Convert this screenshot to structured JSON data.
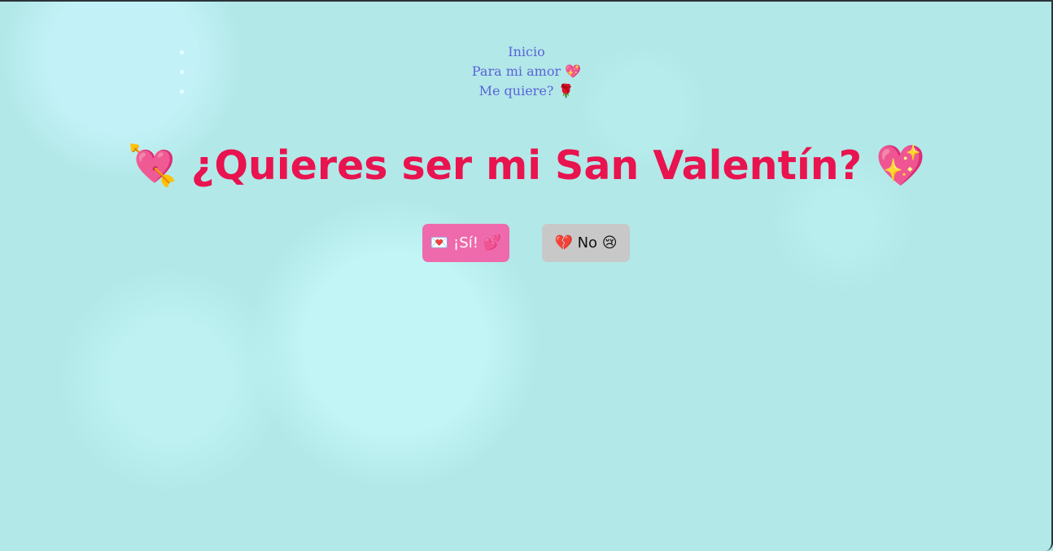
{
  "nav": {
    "items": [
      {
        "label": "Inicio"
      },
      {
        "label": "Para mi amor 💖"
      },
      {
        "label": "Me quiere? 🌹"
      }
    ]
  },
  "hero": {
    "title": "💘 ¿Quieres ser mi San Valentín? 💖"
  },
  "buttons": {
    "yes_label": "💌 ¡Sí! 💕",
    "no_label": "💔 No 😢"
  },
  "colors": {
    "background": "#b2e8e8",
    "title": "#e8134f",
    "nav_link": "#5b63d9",
    "yes_button": "#ee6aac",
    "no_button": "#c8c8c8"
  }
}
